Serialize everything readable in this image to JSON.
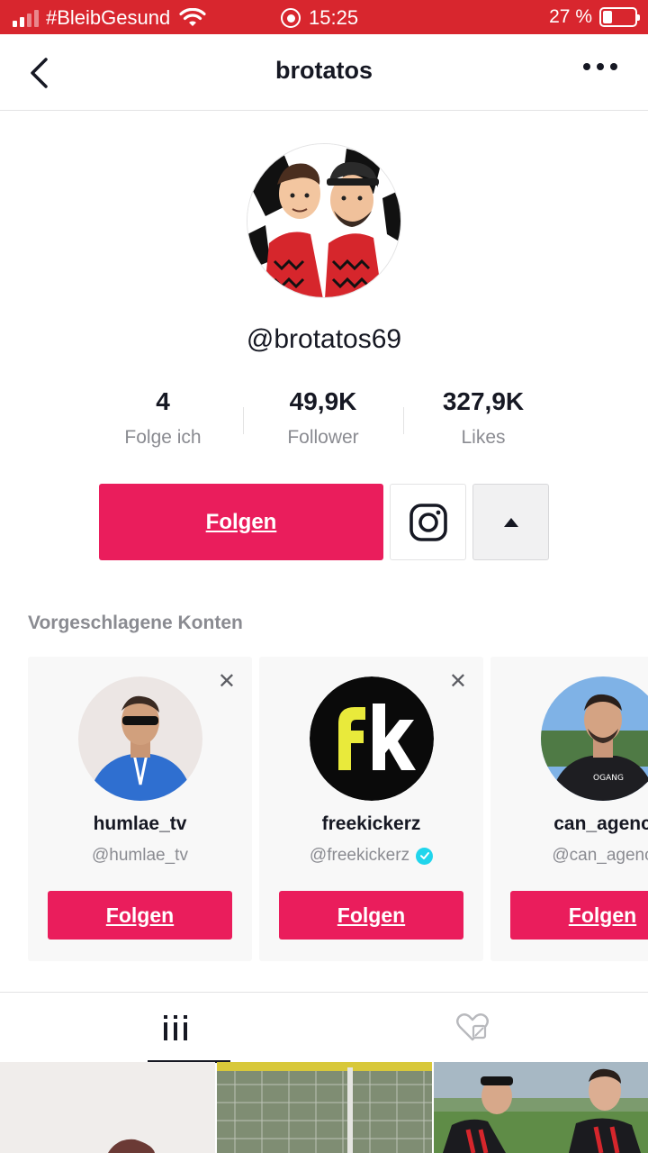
{
  "status_bar": {
    "carrier": "#BleibGesund",
    "time": "15:25",
    "battery": "27 %",
    "battery_level": 0.27,
    "bar_color": "#d8262e"
  },
  "nav": {
    "title": "brotatos",
    "back_icon": "chevron-left-icon",
    "more_icon": "more-dots-icon"
  },
  "profile": {
    "handle": "@brotatos69",
    "stats": [
      {
        "value": "4",
        "label": "Folge ich"
      },
      {
        "value": "49,9K",
        "label": "Follower"
      },
      {
        "value": "327,9K",
        "label": "Likes"
      }
    ],
    "follow_label": "Folgen",
    "accent": "#ea1d5c"
  },
  "suggestions": {
    "title": "Vorgeschlagene Konten",
    "cards": [
      {
        "name": "humlae_tv",
        "username": "@humlae_tv",
        "verified": false,
        "follow_label": "Folgen"
      },
      {
        "name": "freekickerz",
        "username": "@freekickerz",
        "verified": true,
        "follow_label": "Folgen"
      },
      {
        "name": "can_agenc",
        "username": "@can_agenc",
        "verified": false,
        "follow_label": "Folgen"
      }
    ]
  },
  "tabs": [
    {
      "icon": "videos-grid-icon",
      "active": true
    },
    {
      "icon": "liked-videos-icon",
      "active": false
    }
  ]
}
